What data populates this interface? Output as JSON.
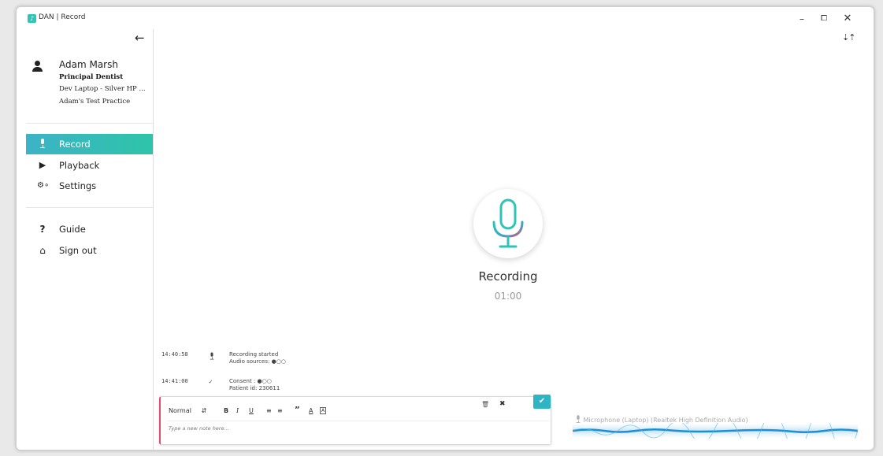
{
  "window": {
    "title": "DAN | Record",
    "app_icon_glyph": "♪",
    "controls": {
      "minimize": "–",
      "maximize": "⧠",
      "close": "✕"
    },
    "accent_color": "#2ec4b6"
  },
  "sidebar": {
    "back_icon": "arrow-left-icon",
    "user": {
      "name": "Adam Marsh",
      "role": "Principal Dentist",
      "device": "Dev Laptop - Silver HP ...",
      "practice": "Adam's Test Practice"
    },
    "nav": [
      {
        "label": "Record",
        "icon": "microphone-icon",
        "active": true
      },
      {
        "label": "Playback",
        "icon": "play-icon",
        "active": false
      },
      {
        "label": "Settings",
        "icon": "gears-icon",
        "active": false
      }
    ],
    "secondary_nav": [
      {
        "label": "Guide",
        "icon": "question-icon"
      },
      {
        "label": "Sign out",
        "icon": "home-icon"
      }
    ]
  },
  "main": {
    "status": "Recording",
    "timer": "01:00",
    "log": [
      {
        "time": "14:40:58",
        "icon": "microphone-icon",
        "line1": "Recording started",
        "line2": "Audio sources: ●○○"
      },
      {
        "time": "14:41:00",
        "icon": "check-icon",
        "line1": "Consent : ●○○",
        "line2": "Patient id: 230611"
      }
    ],
    "note_editor": {
      "style_select": "Normal",
      "placeholder": "Type a new note here...",
      "buttons": {
        "bold": "B",
        "italic": "I",
        "underline": "U",
        "quote": "”",
        "color": "A"
      }
    },
    "audio_source": "Microphone (Laptop) (Realtek High Definition Audio)"
  }
}
